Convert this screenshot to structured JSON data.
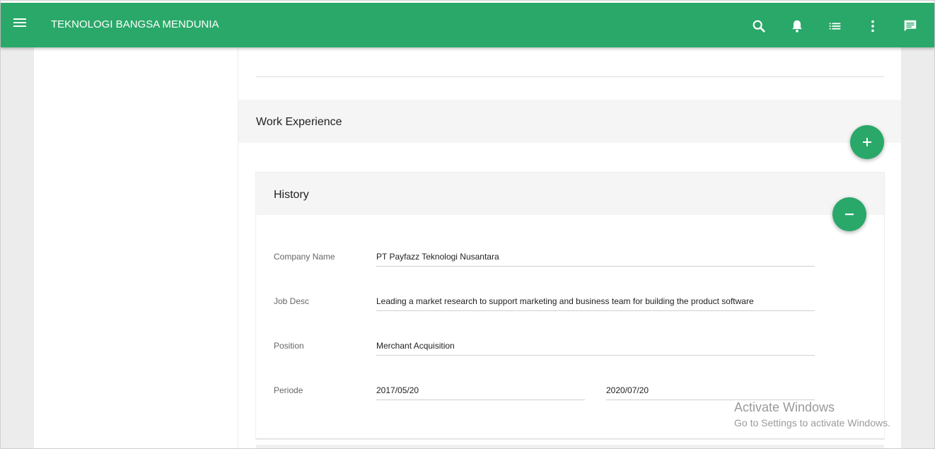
{
  "theme": {
    "accent": "#2aa869"
  },
  "header": {
    "title": "TEKNOLOGI BANGSA MENDUNIA",
    "icons": [
      "menu-icon",
      "search-icon",
      "bell-icon",
      "list-icon",
      "more-vert-icon",
      "message-icon"
    ]
  },
  "work_experience": {
    "title": "Work Experience",
    "add_icon": "plus-icon"
  },
  "history": {
    "title": "History",
    "remove_icon": "minus-icon",
    "fields": {
      "company_name": {
        "label": "Company Name",
        "value": "PT Payfazz Teknologi Nusantara"
      },
      "job_desc": {
        "label": "Job Desc",
        "value": "Leading a market research to support marketing and business team for building the product software"
      },
      "position": {
        "label": "Position",
        "value": "Merchant Acquisition"
      },
      "periode": {
        "label": "Periode",
        "start": "2017/05/20",
        "end": "2020/07/20"
      }
    }
  },
  "watermark": {
    "line1": "Activate Windows",
    "line2": "Go to Settings to activate Windows."
  }
}
